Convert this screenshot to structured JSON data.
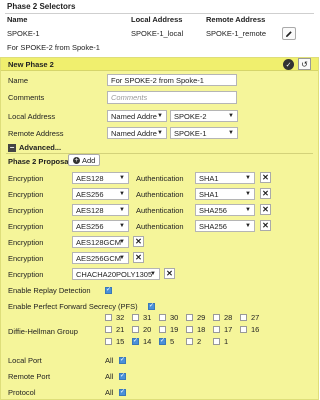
{
  "selectors": {
    "title": "Phase 2 Selectors",
    "columns": [
      "Name",
      "Local Address",
      "Remote Address"
    ],
    "row": {
      "name": "SPOKE-1",
      "local": "SPOKE-1_local",
      "remote": "SPOKE-1_remote",
      "comment": "For SPOKE-2 from Spoke-1"
    }
  },
  "form": {
    "title": "New Phase 2",
    "name_label": "Name",
    "name_value": "For SPOKE-2 from Spoke-1",
    "comments_label": "Comments",
    "comments_placeholder": "Comments",
    "local_label": "Local Address",
    "local_type": "Named Addre",
    "local_value": "SPOKE-2",
    "remote_label": "Remote Address",
    "remote_type": "Named Addre",
    "remote_value": "SPOKE-1",
    "advanced_label": "Advanced...",
    "proposal_label": "Phase 2 Proposal",
    "add_label": "Add",
    "encryption_label": "Encryption",
    "authentication_label": "Authentication",
    "proposals": [
      {
        "enc": "AES128",
        "auth": "SHA1"
      },
      {
        "enc": "AES256",
        "auth": "SHA1"
      },
      {
        "enc": "AES128",
        "auth": "SHA256"
      },
      {
        "enc": "AES256",
        "auth": "SHA256"
      }
    ],
    "gcm_proposals": [
      "AES128GCM",
      "AES256GCM",
      "CHACHA20POLY1305"
    ],
    "replay_label": "Enable Replay Detection",
    "replay_checked": true,
    "pfs_label": "Enable Perfect Forward Secrecy (PFS)",
    "pfs_checked": true,
    "dh_label": "Diffie-Hellman Group",
    "dh_groups": [
      {
        "n": "32",
        "on": false
      },
      {
        "n": "31",
        "on": false
      },
      {
        "n": "30",
        "on": false
      },
      {
        "n": "29",
        "on": false
      },
      {
        "n": "28",
        "on": false
      },
      {
        "n": "27",
        "on": false
      },
      {
        "n": "21",
        "on": false
      },
      {
        "n": "20",
        "on": false
      },
      {
        "n": "19",
        "on": false
      },
      {
        "n": "18",
        "on": false
      },
      {
        "n": "17",
        "on": false
      },
      {
        "n": "16",
        "on": false
      },
      {
        "n": "15",
        "on": false
      },
      {
        "n": "14",
        "on": true
      },
      {
        "n": "5",
        "on": true
      },
      {
        "n": "2",
        "on": false
      },
      {
        "n": "1",
        "on": false
      }
    ],
    "local_port_label": "Local Port",
    "remote_port_label": "Remote Port",
    "protocol_label": "Protocol",
    "all_label": "All"
  },
  "icons": {
    "edit": "pencil-icon",
    "ok": "check-icon",
    "undo": "undo-icon",
    "close": "close-icon",
    "add": "plus-icon",
    "collapse": "minus-icon"
  }
}
